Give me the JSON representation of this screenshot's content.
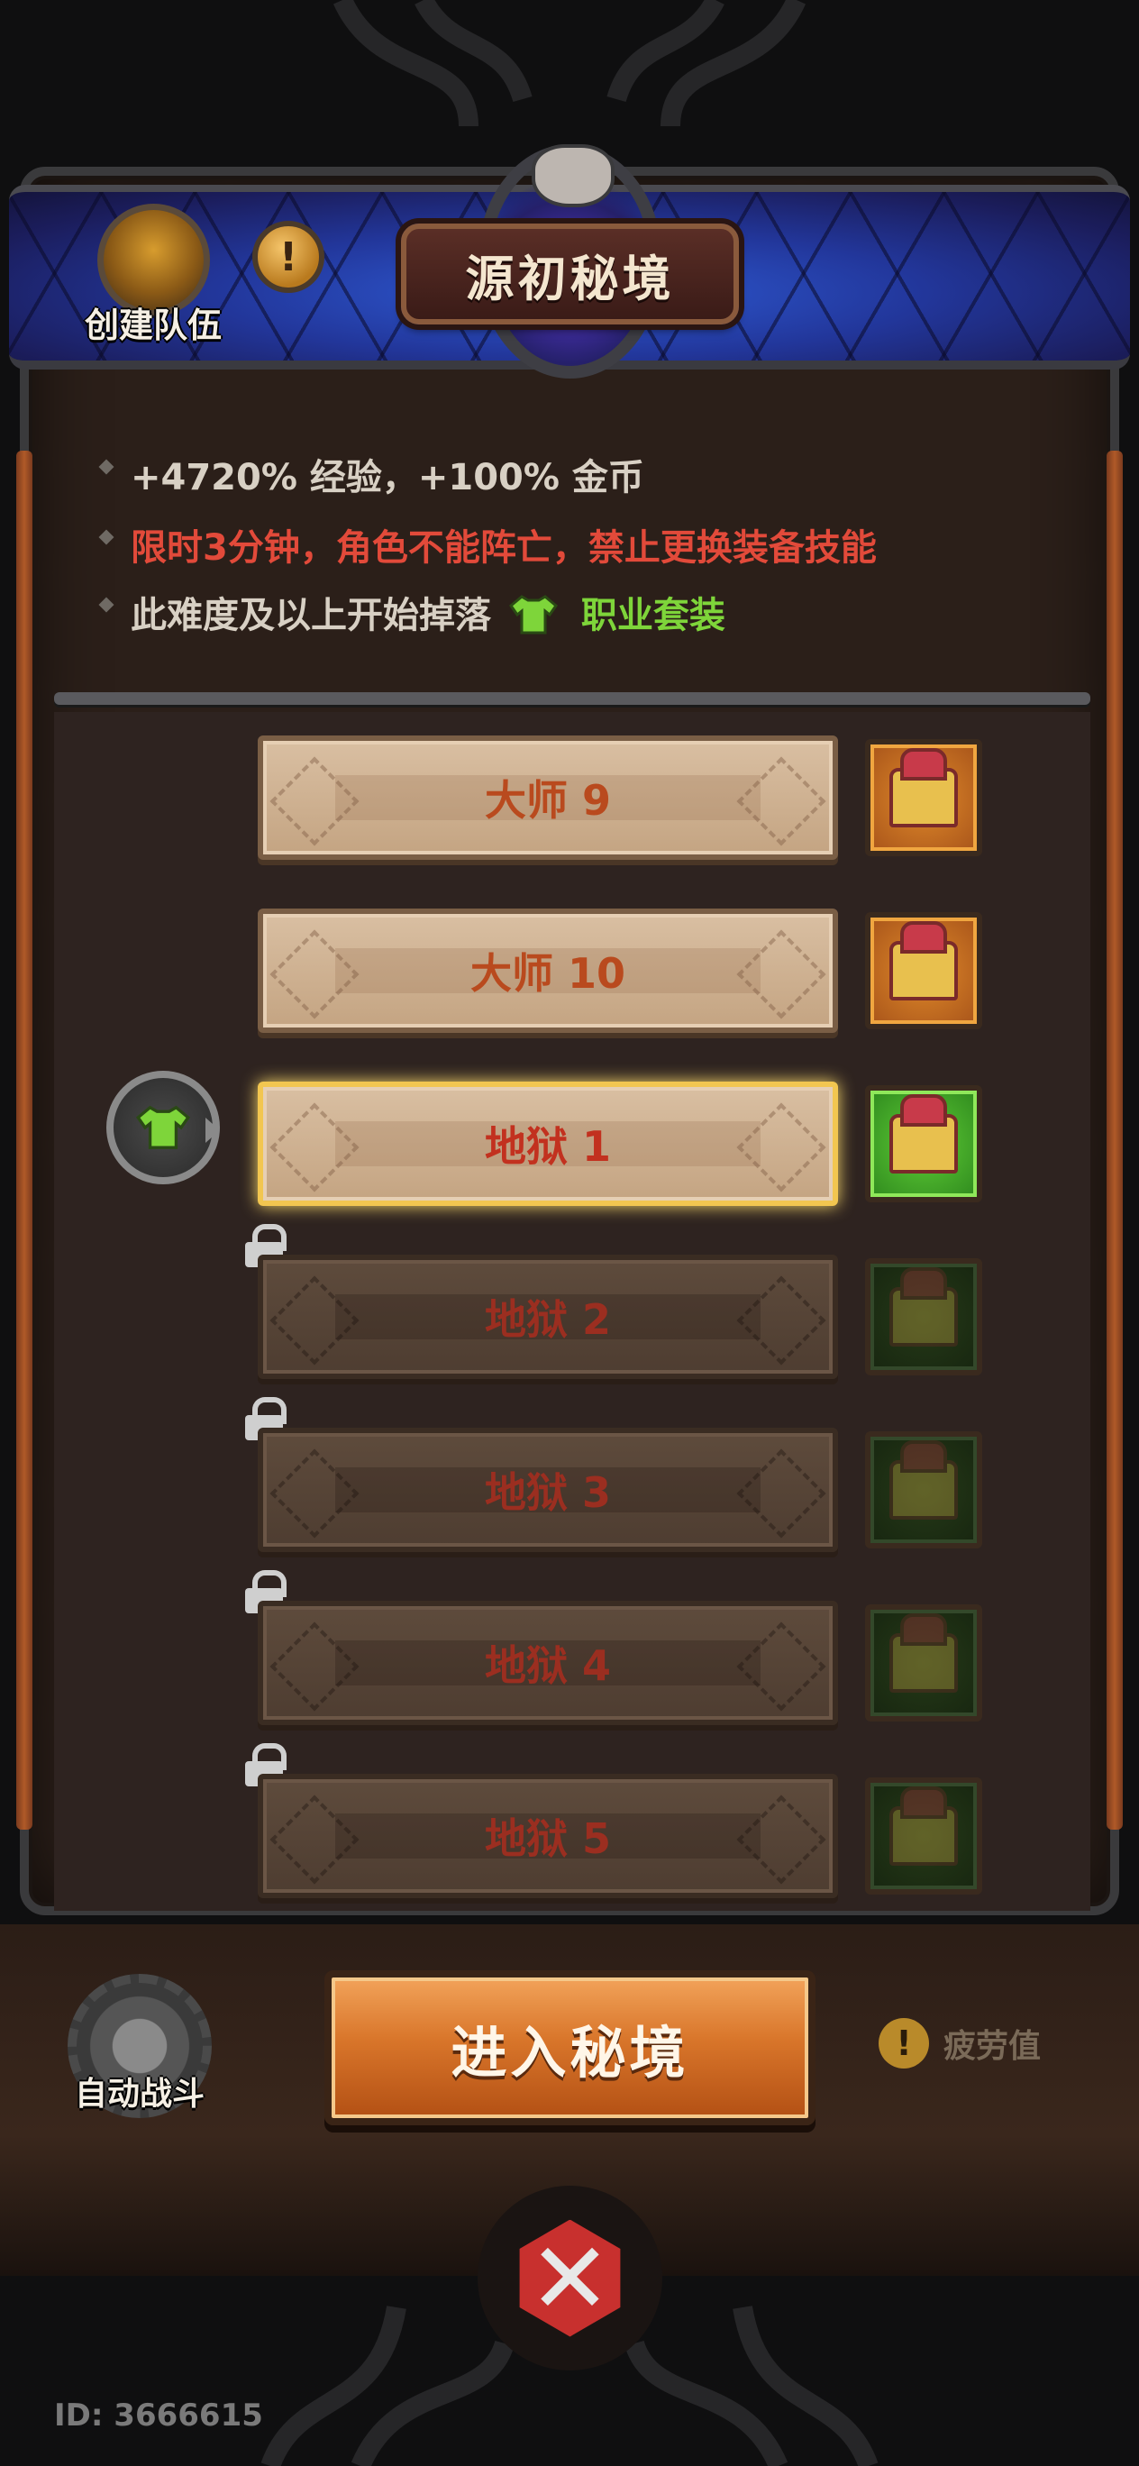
{
  "header": {
    "create_team_label": "创建队伍",
    "info_icon_glyph": "!",
    "title": "源初秘境"
  },
  "info": {
    "line1": "+4720% 经验，+100% 金币",
    "line2": "限时3分钟，角色不能阵亡，禁止更换装备技能",
    "line3_prefix": "此难度及以上开始掉落",
    "line3_highlight": "职业套装"
  },
  "levels": [
    {
      "label": "大师 9",
      "state": "unlocked",
      "chest": "orange"
    },
    {
      "label": "大师 10",
      "state": "unlocked",
      "chest": "orange"
    },
    {
      "label": "地狱 1",
      "state": "selected",
      "chest": "green"
    },
    {
      "label": "地狱 2",
      "state": "locked",
      "chest": "dark"
    },
    {
      "label": "地狱 3",
      "state": "locked",
      "chest": "dark"
    },
    {
      "label": "地狱 4",
      "state": "locked",
      "chest": "dark"
    },
    {
      "label": "地狱 5",
      "state": "locked",
      "chest": "dark"
    }
  ],
  "bottom": {
    "auto_battle_label": "自动战斗",
    "enter_label": "进入秘境",
    "fatigue_label": "疲劳值",
    "fatigue_icon_glyph": "!",
    "close_glyph": "✕"
  },
  "footer": {
    "player_id": "ID: 3666615"
  },
  "colors": {
    "accent_orange": "#d8752a",
    "warning_red": "#e24a3a",
    "set_green": "#7ed53a",
    "header_blue": "#2f5cd6"
  }
}
